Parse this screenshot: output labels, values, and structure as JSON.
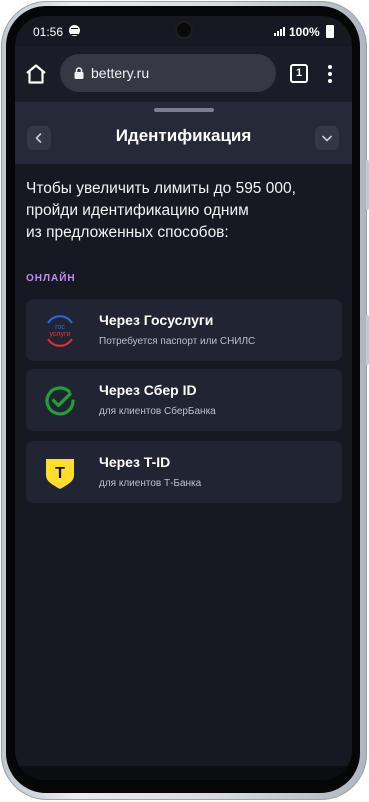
{
  "status_bar": {
    "time": "01:56",
    "battery": "100%"
  },
  "browser": {
    "url": "bettery.ru",
    "tab_count": "1"
  },
  "sheet": {
    "title": "Идентификация",
    "intro_lines": [
      "Чтобы увеличить лимиты до 595 000,",
      "пройди идентификацию одним",
      "из предложенных способов:"
    ],
    "section_label": "ОНЛАЙН",
    "methods": [
      {
        "title": "Через Госуслуги",
        "subtitle": "Потребуется паспорт или СНИЛС",
        "icon": "gosuslugi-logo-icon",
        "logo_text": [
          "гос",
          "услуги"
        ]
      },
      {
        "title": "Через Сбер ID",
        "subtitle": "для клиентов СберБанка",
        "icon": "sber-id-logo-icon"
      },
      {
        "title": "Через T-ID",
        "subtitle": "для клиентов Т-Банка",
        "icon": "t-bank-logo-icon",
        "logo_text": [
          "Т"
        ]
      }
    ]
  },
  "colors": {
    "background": "#161922",
    "card": "#212533",
    "header": "#252938",
    "accent_label": "#c08cf5",
    "sber_green": "#21a038",
    "tbank_yellow": "#ffdd2d"
  }
}
